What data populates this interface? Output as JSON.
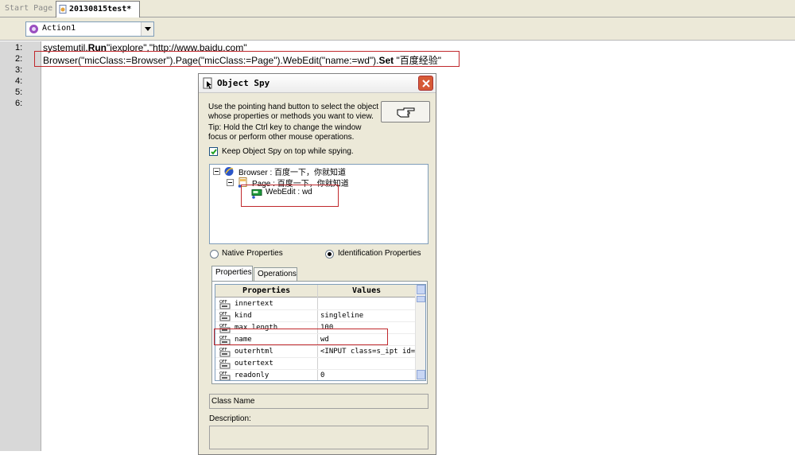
{
  "tabs": {
    "start_page": "Start Page",
    "active": "20130815test*"
  },
  "action_select": {
    "value": "Action1"
  },
  "editor": {
    "line_numbers": [
      "1:",
      "2:",
      "3:",
      "4:",
      "5:",
      "6:"
    ],
    "line1": {
      "part1": "systemutil.",
      "bold": "Run",
      "part2": "\"iexplore\",\"http://www.baidu.com\""
    },
    "line2": {
      "part1": "Browser(\"micClass:=Browser\").Page(\"micClass:=Page\").WebEdit(\"name:=wd\").",
      "bold": "Set",
      "part2": " \"百度经验\""
    }
  },
  "object_spy": {
    "title": "Object Spy",
    "instruction1": "Use the pointing hand button to select the object",
    "instruction2": "whose properties or methods you want to view.",
    "tip1": "Tip: Hold the Ctrl key to change the window",
    "tip2": "focus or perform other mouse operations.",
    "keep_on_top_label": "Keep Object Spy on top while spying.",
    "keep_on_top_checked": true,
    "tree": [
      {
        "label": "Browser : 百度一下，你就知道",
        "icon": "browser-icon"
      },
      {
        "label": "Page : 百度一下，你就知道",
        "icon": "page-icon"
      },
      {
        "label": "WebEdit : wd",
        "icon": "webedit-icon"
      }
    ],
    "radio_native": "Native Properties",
    "radio_identification": "Identification Properties",
    "selected_radio": "Identification Properties",
    "tab_properties": "Properties",
    "tab_operations": "Operations",
    "grid_headers": {
      "properties": "Properties",
      "values": "Values"
    },
    "rows": [
      {
        "name": "innertext",
        "value": ""
      },
      {
        "name": "kind",
        "value": "singleline"
      },
      {
        "name": "max length",
        "value": "100"
      },
      {
        "name": "name",
        "value": "wd"
      },
      {
        "name": "outerhtml",
        "value": "<INPUT class=s_ipt id="
      },
      {
        "name": "outertext",
        "value": ""
      },
      {
        "name": "readonly",
        "value": "0"
      }
    ],
    "class_name_label": "Class Name",
    "description_label": "Description:"
  },
  "colors": {
    "highlight": "#c0282c",
    "dialog_bg": "#ece9d8"
  }
}
